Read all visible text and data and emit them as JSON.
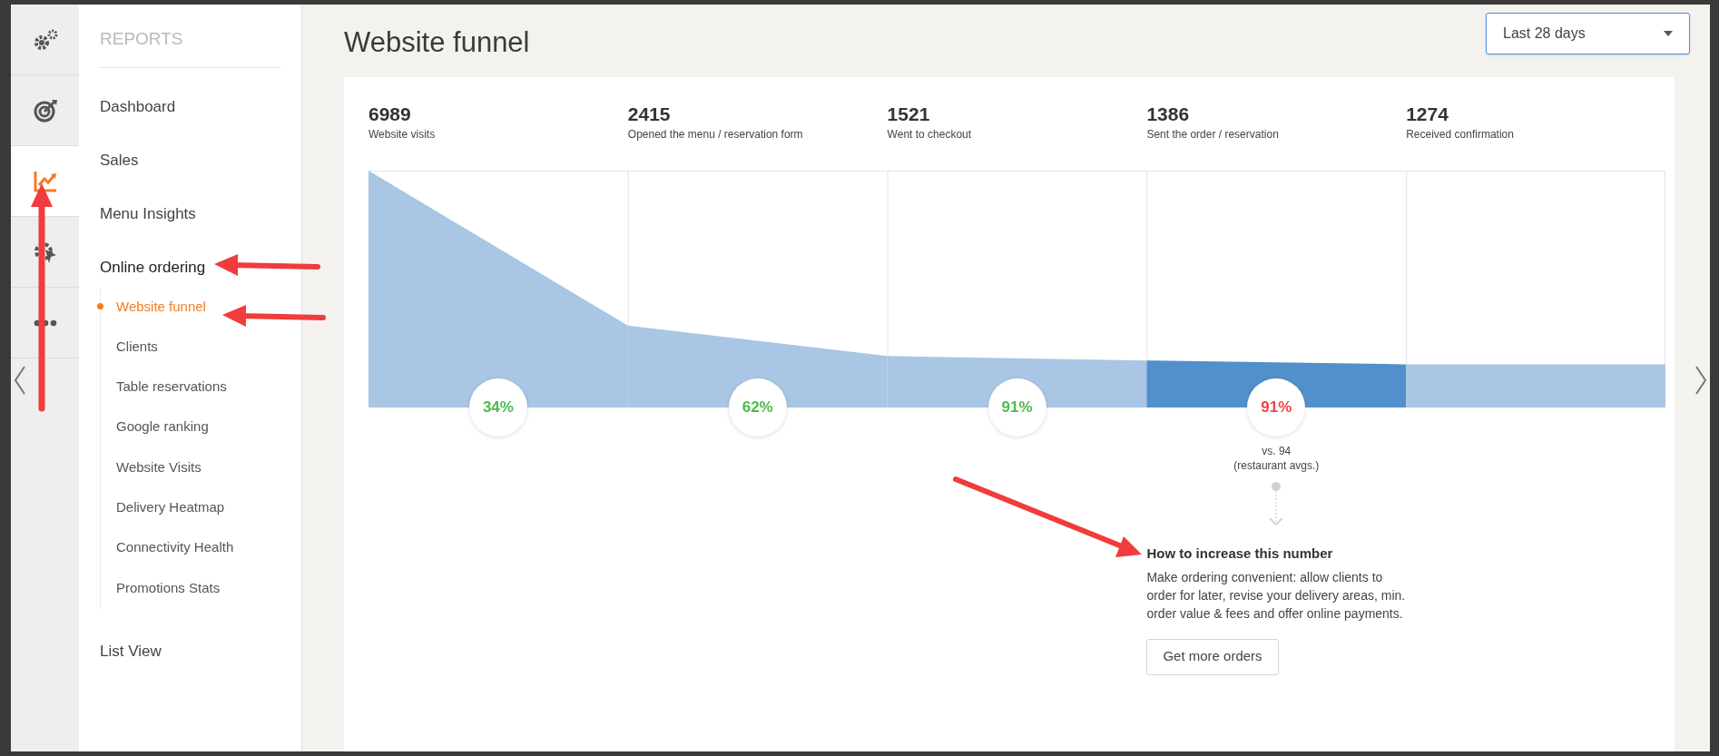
{
  "rail": [
    {
      "selected": false
    },
    {
      "selected": false
    },
    {
      "selected": true
    },
    {
      "selected": false
    },
    {
      "selected": false
    }
  ],
  "sidebar": {
    "heading": "REPORTS",
    "items": [
      {
        "label": "Dashboard",
        "selected": false
      },
      {
        "label": "Sales",
        "selected": false
      },
      {
        "label": "Menu Insights",
        "selected": false
      },
      {
        "label": "Online ordering",
        "selected": false,
        "expanded": true,
        "children": [
          {
            "label": "Website funnel",
            "selected": true
          },
          {
            "label": "Clients",
            "selected": false
          },
          {
            "label": "Table reservations",
            "selected": false
          },
          {
            "label": "Google ranking",
            "selected": false
          },
          {
            "label": "Website Visits",
            "selected": false
          },
          {
            "label": "Delivery Heatmap",
            "selected": false
          },
          {
            "label": "Connectivity Health",
            "selected": false
          },
          {
            "label": "Promotions Stats",
            "selected": false
          }
        ]
      },
      {
        "label": "List View",
        "selected": false
      }
    ]
  },
  "page": {
    "title": "Website funnel",
    "period_select": {
      "value": "Last 28 days"
    }
  },
  "funnel": {
    "stages": [
      {
        "count": "6989",
        "label": "Website visits",
        "selected": false,
        "conversion": {
          "value": "34%",
          "below_average": false
        }
      },
      {
        "count": "2415",
        "label": "Opened the menu / reservation form",
        "selected": false,
        "conversion": {
          "value": "62%",
          "below_average": false
        }
      },
      {
        "count": "1521",
        "label": "Went to checkout",
        "selected": false,
        "conversion": {
          "value": "91%",
          "below_average": false
        }
      },
      {
        "count": "1386",
        "label": "Sent the order / reservation",
        "selected": true,
        "conversion": {
          "value": "91%",
          "below_average": true
        }
      },
      {
        "count": "1274",
        "label": "Received confirmation",
        "selected": false
      }
    ]
  },
  "tip": {
    "comparison": [
      "vs. 94",
      "(restaurant avgs.)"
    ],
    "heading": "How to increase this number",
    "text": "Make ordering convenient: allow clients to order for later, revise your delivery areas, min. order value & fees and offer online payments.",
    "button": "Get more orders"
  }
}
